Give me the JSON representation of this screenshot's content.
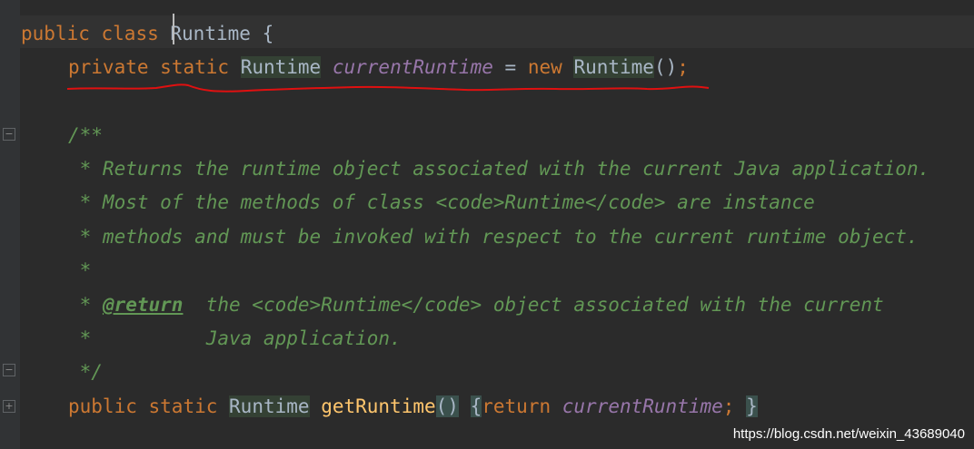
{
  "code": {
    "line1": {
      "kw1": "public",
      "kw2": "class",
      "classname": "Runtime",
      "brace": "{"
    },
    "line2": {
      "kw1": "private",
      "kw2": "static",
      "type": "Runtime",
      "field": "currentRuntime",
      "eq": "=",
      "kw3": "new",
      "ctor": "Runtime",
      "parens": "()",
      "semi": ";"
    },
    "doc": {
      "open": "/**",
      "l1": " * Returns the runtime object associated with the current Java application.",
      "l2": " * Most of the methods of class <code>Runtime</code> are instance",
      "l3": " * methods and must be invoked with respect to the current runtime object.",
      "l4": " *",
      "l5_star": " * ",
      "l5_tag": "@return",
      "l5_rest": "  the <code>Runtime</code> object associated with the current",
      "l6": " *          Java application.",
      "close": " */"
    },
    "line_last": {
      "kw1": "public",
      "kw2": "static",
      "type": "Runtime",
      "method": "getRuntime",
      "parens": "()",
      "brace_open": "{",
      "kw3": "return",
      "field": "currentRuntime",
      "semi": ";",
      "brace_close": "}"
    }
  },
  "watermark": "https://blog.csdn.net/weixin_43689040",
  "colors": {
    "background": "#2b2b2b",
    "keyword": "#cc7832",
    "field": "#9876aa",
    "method": "#ffc66d",
    "doc": "#629755",
    "underline": "#e01010"
  }
}
